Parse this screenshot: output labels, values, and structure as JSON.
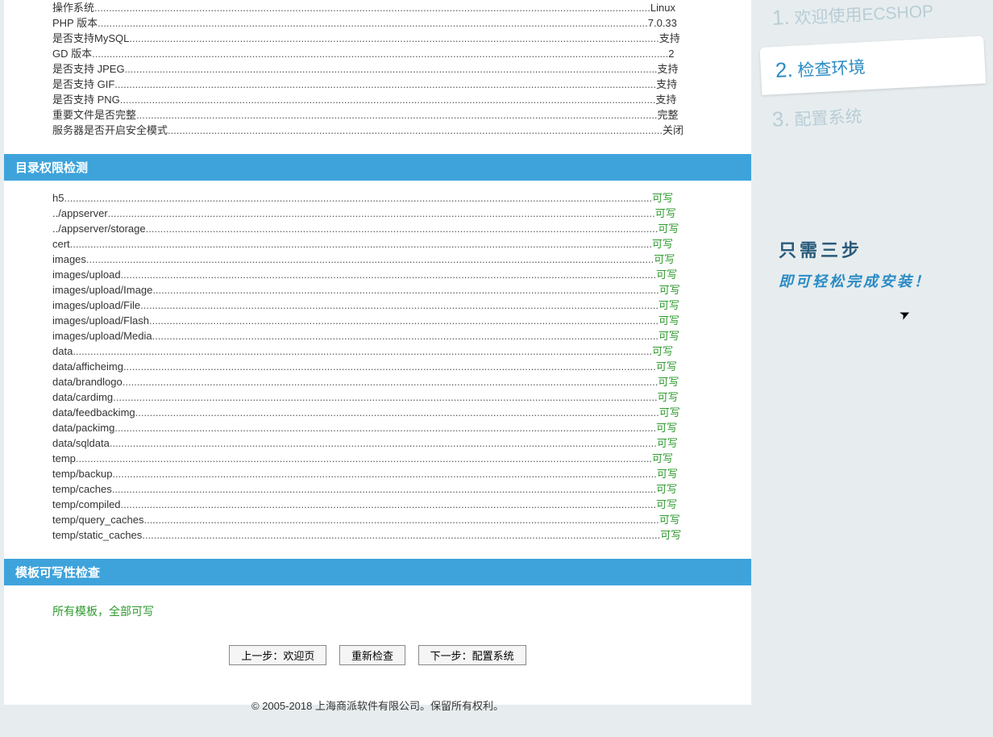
{
  "sysinfo": [
    {
      "label": "操作系统",
      "value": "Linux",
      "green": false
    },
    {
      "label": "PHP 版本",
      "value": "7.0.33",
      "green": false
    },
    {
      "label": "是否支持MySQL",
      "value": "支持",
      "green": false
    },
    {
      "label": "GD 版本",
      "value": "2",
      "green": false
    },
    {
      "label": "是否支持 JPEG",
      "value": "支持",
      "green": false
    },
    {
      "label": "是否支持 GIF",
      "value": "支持",
      "green": false
    },
    {
      "label": "是否支持 PNG",
      "value": "支持",
      "green": false
    },
    {
      "label": "重要文件是否完整",
      "value": "完整",
      "green": false
    },
    {
      "label": "服务器是否开启安全模式",
      "value": "关闭",
      "green": false
    }
  ],
  "section_dir_title": "目录权限检测",
  "dirs": [
    {
      "label": "h5",
      "value": "可写"
    },
    {
      "label": "../appserver",
      "value": "可写"
    },
    {
      "label": "../appserver/storage",
      "value": "可写"
    },
    {
      "label": "cert",
      "value": "可写"
    },
    {
      "label": "images",
      "value": "可写"
    },
    {
      "label": "images/upload",
      "value": "可写"
    },
    {
      "label": "images/upload/Image",
      "value": "可写"
    },
    {
      "label": "images/upload/File",
      "value": "可写"
    },
    {
      "label": "images/upload/Flash",
      "value": "可写"
    },
    {
      "label": "images/upload/Media",
      "value": "可写"
    },
    {
      "label": "data",
      "value": "可写"
    },
    {
      "label": "data/afficheimg",
      "value": "可写"
    },
    {
      "label": "data/brandlogo",
      "value": "可写"
    },
    {
      "label": "data/cardimg",
      "value": "可写"
    },
    {
      "label": "data/feedbackimg",
      "value": "可写"
    },
    {
      "label": "data/packimg",
      "value": "可写"
    },
    {
      "label": "data/sqldata",
      "value": "可写"
    },
    {
      "label": "temp",
      "value": "可写"
    },
    {
      "label": "temp/backup",
      "value": "可写"
    },
    {
      "label": "temp/caches",
      "value": "可写"
    },
    {
      "label": "temp/compiled",
      "value": "可写"
    },
    {
      "label": "temp/query_caches",
      "value": "可写"
    },
    {
      "label": "temp/static_caches",
      "value": "可写"
    }
  ],
  "section_template_title": "模板可写性检查",
  "template_check_text": "所有模板，全部可写",
  "buttons": {
    "prev": "上一步：欢迎页",
    "recheck": "重新检查",
    "next": "下一步：配置系统"
  },
  "footer_text": "© 2005-2018 上海商派软件有限公司。保留所有权利。",
  "steps": {
    "s1": "欢迎使用ECSHOP",
    "s2": "检查环境",
    "s3": "配置系统"
  },
  "slogan": {
    "line1": "只需三步",
    "line2": "即可轻松完成安装！"
  }
}
